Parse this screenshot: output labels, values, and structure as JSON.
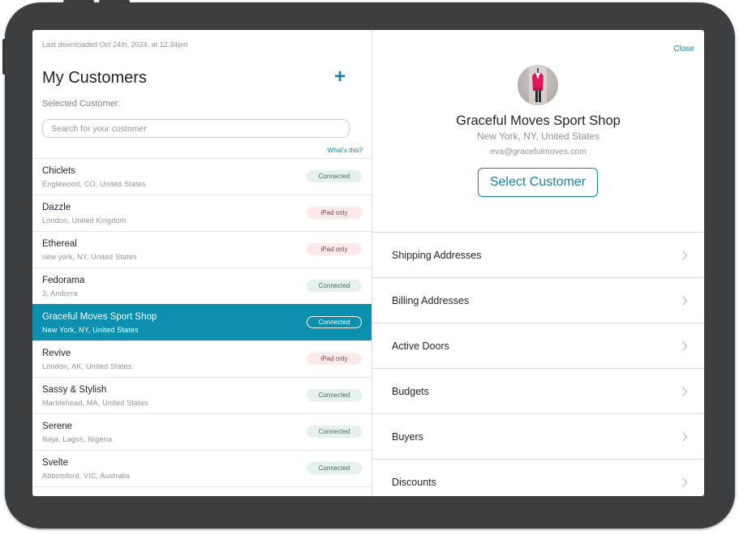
{
  "left": {
    "last_downloaded": "Last downloaded Oct 24th, 2024, at 12:34pm",
    "title": "My Customers",
    "add_icon": "+",
    "selected_label": "Selected Customer:",
    "search_placeholder": "Search for your customer",
    "search_value": "",
    "whats_this": "What's this?",
    "customers": [
      {
        "name": "Chiclets",
        "location": "Englewood, CO, United States",
        "status": "Connected"
      },
      {
        "name": "Dazzle",
        "location": "London, United Kingdom",
        "status": "iPad only"
      },
      {
        "name": "Ethereal",
        "location": "new york, NY, United States",
        "status": "iPad only"
      },
      {
        "name": "Fedorama",
        "location": "3, Andorra",
        "status": "Connected"
      },
      {
        "name": "Graceful Moves Sport Shop",
        "location": "New York, NY, United States",
        "status": "Connected"
      },
      {
        "name": "Revive",
        "location": "London, AK, United States",
        "status": "iPad only"
      },
      {
        "name": "Sassy & Stylish",
        "location": "Marblehead, MA, United States",
        "status": "Connected"
      },
      {
        "name": "Serene",
        "location": "Ikeja, Lagos, Nigeria",
        "status": "Connected"
      },
      {
        "name": "Svelte",
        "location": "Abbotsford, VIC, Australia",
        "status": "Connected"
      },
      {
        "name": "",
        "location": "",
        "status": ""
      }
    ],
    "selected_index": 4
  },
  "right": {
    "close_label": "Close",
    "customer_name": "Graceful Moves Sport Shop",
    "customer_location": "New York, NY, United States",
    "customer_email": "eva@gracefulmoves.com",
    "select_button": "Select Customer",
    "menu": [
      {
        "label": "Shipping Addresses"
      },
      {
        "label": "Billing Addresses"
      },
      {
        "label": "Active Doors"
      },
      {
        "label": "Budgets"
      },
      {
        "label": "Buyers"
      },
      {
        "label": "Discounts"
      }
    ]
  },
  "colors": {
    "accent": "#17819d",
    "selected_row": "#0d8fae",
    "connected_bg": "#e6f1ee",
    "ipad_only_bg": "#fde9ea",
    "device_frame": "#3c3e40"
  },
  "icons": {
    "add": "plus-icon",
    "chevron": "chevron-right-icon",
    "avatar": "customer-avatar-photo"
  }
}
